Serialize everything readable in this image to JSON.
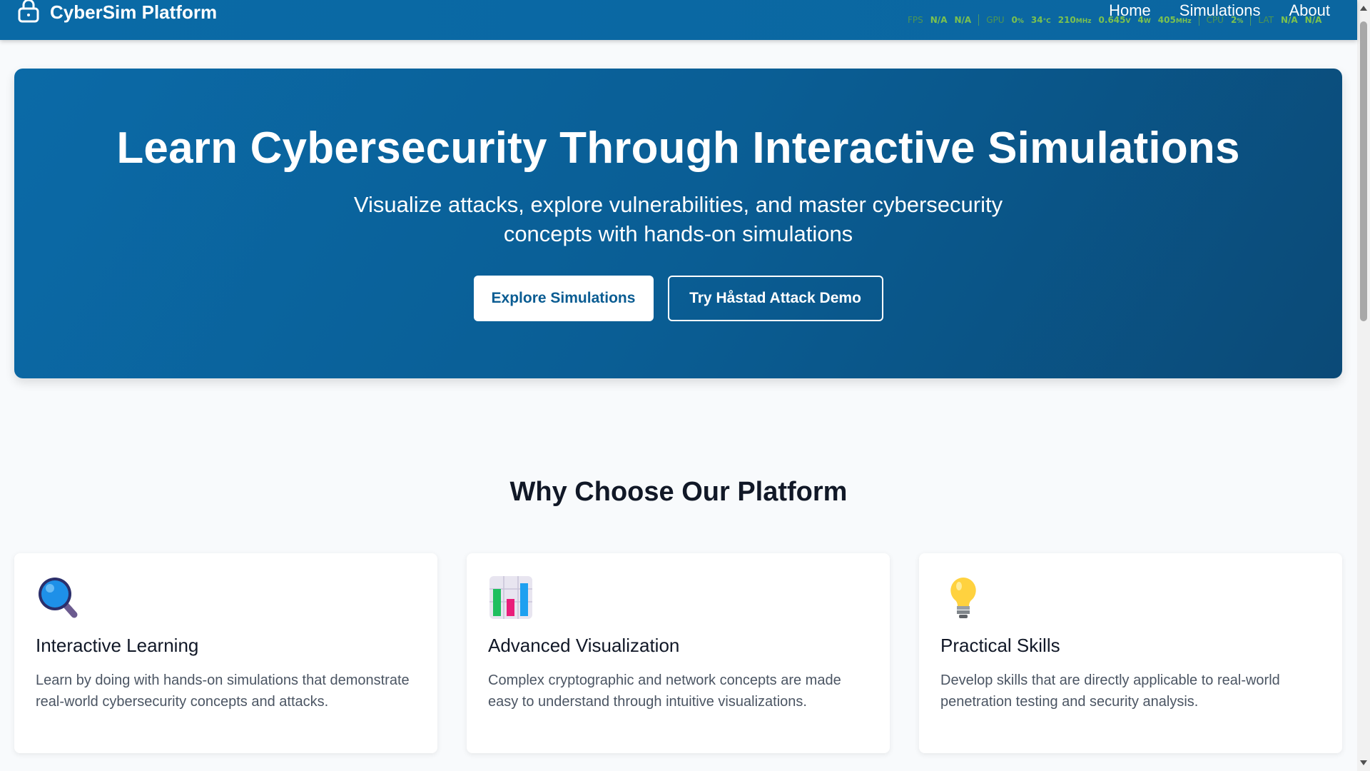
{
  "nav": {
    "brand": "CyberSim Platform",
    "brand_icon": "lock-icon",
    "links": [
      {
        "label": "Home"
      },
      {
        "label": "Simulations"
      },
      {
        "label": "About"
      }
    ]
  },
  "perf_overlay": {
    "fps_label": "FPS",
    "fps_val1": "N/A",
    "fps_val2": "N/A",
    "gpu_label": "GPU",
    "gpu_usage": "0",
    "gpu_usage_unit": "%",
    "gpu_temp": "34",
    "gpu_temp_unit": "°C",
    "gpu_clock": "210",
    "gpu_clock_unit": "MHz",
    "gpu_volt": "0.645",
    "gpu_volt_unit": "V",
    "gpu_power": "4",
    "gpu_power_unit": "W",
    "gpu_mem": "405",
    "gpu_mem_unit": "MHz",
    "cpu_label": "CPU",
    "cpu_usage": "2",
    "cpu_usage_unit": "%",
    "lat_label": "LAT",
    "lat_val1": "N/A",
    "lat_val2": "N/A",
    "color": "#7cc24e"
  },
  "hero": {
    "title": "Learn Cybersecurity Through Interactive Simulations",
    "subtitle": "Visualize attacks, explore vulnerabilities, and master cybersecurity concepts with hands-on simulations",
    "primary_button": "Explore Simulations",
    "secondary_button": "Try Håstad Attack Demo"
  },
  "features": {
    "title": "Why Choose Our Platform",
    "cards": [
      {
        "icon": "magnifying-glass-icon",
        "title": "Interactive Learning",
        "text": "Learn by doing with hands-on simulations that demonstrate real-world cybersecurity concepts and attacks."
      },
      {
        "icon": "bar-chart-icon",
        "title": "Advanced Visualization",
        "text": "Complex cryptographic and network concepts are made easy to understand through intuitive visualizations."
      },
      {
        "icon": "light-bulb-icon",
        "title": "Practical Skills",
        "text": "Develop skills that are directly applicable to real-world penetration testing and security analysis."
      }
    ]
  },
  "colors": {
    "navbar": "#0a6aa6",
    "hero_start": "#0b6aa7",
    "hero_end": "#0b4a77",
    "background": "#f8fafc",
    "primary_text": "#0a5c92"
  }
}
